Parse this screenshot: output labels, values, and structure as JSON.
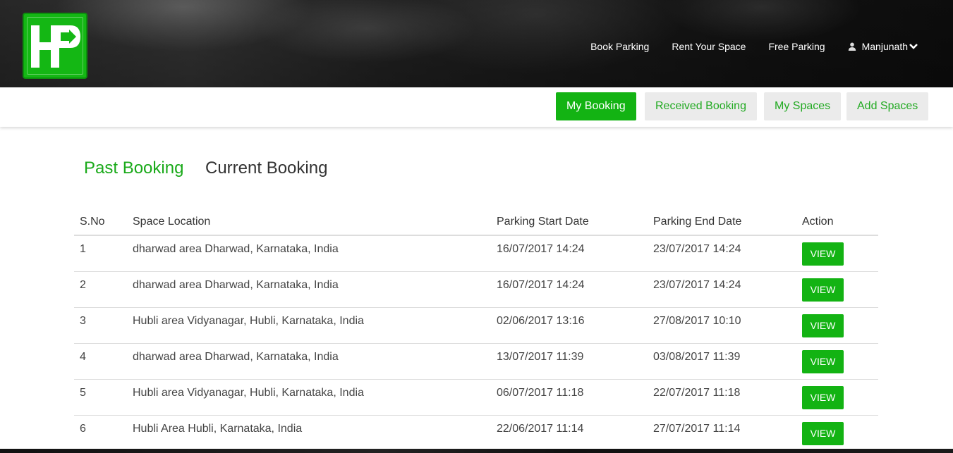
{
  "brand": {
    "logo_text": "HP",
    "accent": "#13b313"
  },
  "nav": {
    "links": [
      "Book Parking",
      "Rent Your Space",
      "Free Parking"
    ],
    "user_name": "Manjunath",
    "user_icon": "user-icon",
    "dropdown_icon": "chevron-down-icon"
  },
  "tabs": [
    {
      "label": "My Booking",
      "active": true
    },
    {
      "label": "Received Booking",
      "active": false
    },
    {
      "label": "My Spaces",
      "active": false
    },
    {
      "label": "Add Spaces",
      "active": false
    }
  ],
  "subtabs": [
    {
      "label": "Past Booking",
      "active": true
    },
    {
      "label": "Current Booking",
      "active": false
    }
  ],
  "table": {
    "headers": [
      "S.No",
      "Space Location",
      "Parking Start Date",
      "Parking End Date",
      "Action"
    ],
    "rows": [
      {
        "sno": "1",
        "location": "dharwad area Dharwad, Karnataka, India",
        "start": "16/07/2017 14:24",
        "end": "23/07/2017 14:24",
        "action": "VIEW"
      },
      {
        "sno": "2",
        "location": "dharwad area Dharwad, Karnataka, India",
        "start": "16/07/2017 14:24",
        "end": "23/07/2017 14:24",
        "action": "VIEW"
      },
      {
        "sno": "3",
        "location": "Hubli area Vidyanagar, Hubli, Karnataka, India",
        "start": "02/06/2017 13:16",
        "end": "27/08/2017 10:10",
        "action": "VIEW"
      },
      {
        "sno": "4",
        "location": "dharwad area Dharwad, Karnataka, India",
        "start": "13/07/2017 11:39",
        "end": "03/08/2017 11:39",
        "action": "VIEW"
      },
      {
        "sno": "5",
        "location": "Hubli area Vidyanagar, Hubli, Karnataka, India",
        "start": "06/07/2017 11:18",
        "end": "22/07/2017 11:18",
        "action": "VIEW"
      },
      {
        "sno": "6",
        "location": "Hubli Area Hubli, Karnataka, India",
        "start": "22/06/2017 11:14",
        "end": "27/07/2017 11:14",
        "action": "VIEW"
      }
    ]
  }
}
